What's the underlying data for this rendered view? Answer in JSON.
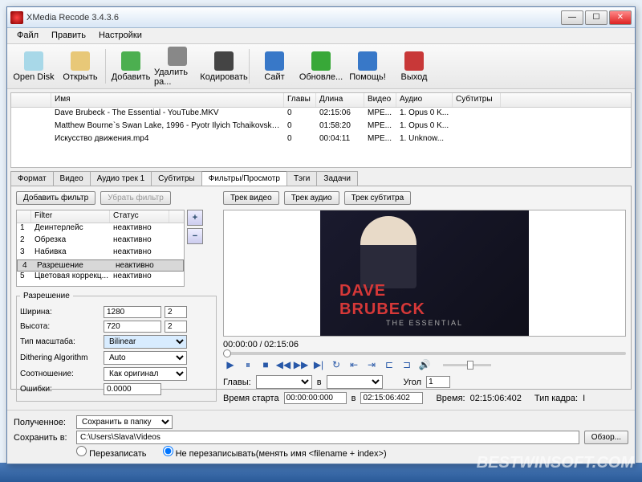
{
  "title": "XMedia Recode 3.4.3.6",
  "menu": [
    "Файл",
    "Править",
    "Настройки"
  ],
  "toolbar": [
    {
      "label": "Open Disk",
      "color": "#a8d8e8"
    },
    {
      "label": "Открыть",
      "color": "#e8c878"
    },
    {
      "label": "Добавить",
      "color": "#4caf50"
    },
    {
      "label": "Удалить ра...",
      "color": "#888"
    },
    {
      "label": "Кодировать",
      "color": "#444"
    },
    {
      "label": "Сайт",
      "color": "#3878c8"
    },
    {
      "label": "Обновле...",
      "color": "#38a838"
    },
    {
      "label": "Помощь!",
      "color": "#3878c8"
    },
    {
      "label": "Выход",
      "color": "#c83838"
    }
  ],
  "filecols": [
    "",
    "Имя",
    "Главы",
    "Длина",
    "Видео",
    "Аудио",
    "Субтитры"
  ],
  "filewidths": [
    50,
    290,
    40,
    60,
    40,
    70,
    60
  ],
  "files": [
    [
      "",
      "Dave Brubeck - The Essential - YouTube.MKV",
      "0",
      "02:15:06",
      "MPE...",
      "1. Opus 0 K...",
      ""
    ],
    [
      "",
      "Matthew Bourne`s Swan Lake, 1996 - Pyotr Ilyich Tchaikovsky ...",
      "0",
      "01:58:20",
      "MPE...",
      "1. Opus 0 K...",
      ""
    ],
    [
      "",
      "Искусство движения.mp4",
      "0",
      "00:04:11",
      "MPE...",
      "1. Unknow...",
      ""
    ]
  ],
  "tabs": [
    "Формат",
    "Видео",
    "Аудио трек 1",
    "Субтитры",
    "Фильтры/Просмотр",
    "Тэги",
    "Задачи"
  ],
  "active_tab": 4,
  "addfilter": "Добавить фильтр",
  "remfilter": "Убрать фильтр",
  "filtercols": [
    "",
    "Filter",
    "Статус"
  ],
  "filters": [
    [
      "1",
      "Деинтерлейс",
      "неактивно"
    ],
    [
      "2",
      "Обрезка",
      "неактивно"
    ],
    [
      "3",
      "Набивка",
      "неактивно"
    ],
    [
      "4",
      "Разрешение",
      "неактивно"
    ],
    [
      "5",
      "Цветовая коррекц...",
      "неактивно"
    ]
  ],
  "sel_filter": 3,
  "res": {
    "legend": "Разрешение",
    "width_l": "Ширина:",
    "width": "1280",
    "width_step": "2",
    "height_l": "Высота:",
    "height": "720",
    "height_step": "2",
    "scale_l": "Тип масштаба:",
    "scale": "Bilinear",
    "dither_l": "Dithering Algorithm",
    "dither": "Auto",
    "ratio_l": "Соотношение:",
    "ratio": "Как оригинал",
    "err_l": "Ошибки:",
    "err": "0.0000"
  },
  "trackbtns": [
    "Трек видео",
    "Трек аудио",
    "Трек субтитра"
  ],
  "album": {
    "l1": "DAVE",
    "l2": "BRUBECK",
    "l3": "THE ESSENTIAL"
  },
  "time_now": "00:00:00",
  "time_total": "02:15:06",
  "chap": {
    "label": "Главы:",
    "to": "в",
    "angle_l": "Угол",
    "angle": "1"
  },
  "timerow": {
    "start_l": "Время старта",
    "start": "00:00:00:000",
    "to": "в",
    "end": "02:15:06:402",
    "time_l": "Время:",
    "time": "02:15:06:402",
    "frame_l": "Тип кадра:",
    "frame": "I"
  },
  "bottom": {
    "got_l": "Полученное:",
    "got": "Сохранить в папку",
    "save_l": "Сохранить в:",
    "path": "C:\\Users\\Slava\\Videos",
    "browse": "Обзор...",
    "r1": "Перезаписать",
    "r2": "Не перезаписывать(менять имя <filename + index>)"
  },
  "watermark": "BESTWINSOFT.COM"
}
